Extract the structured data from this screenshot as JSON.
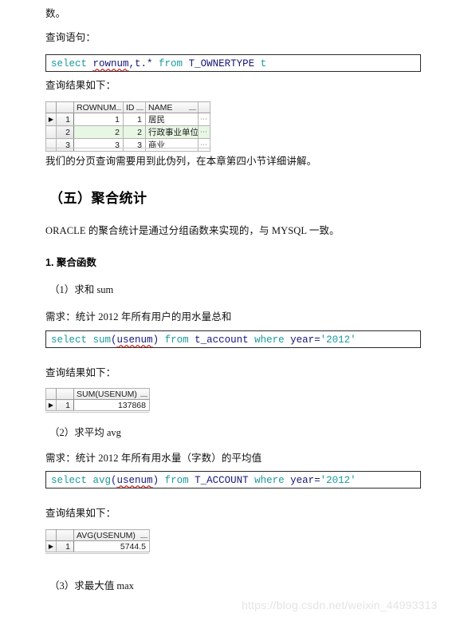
{
  "document": {
    "watermark": "https://blog.csdn.net/weixin_44993313"
  },
  "blocks": {
    "intro_fragment": "数。",
    "label_query_statement": "查询语句：",
    "label_result_1": "查询结果如下：",
    "note_rownum": "我们的分页查询需要用到此伪列，在本章第四小节详细讲解。",
    "section_heading": "（五）聚合统计",
    "section_intro": "ORACLE 的聚合统计是通过分组函数来实现的，与 MYSQL 一致。",
    "subheading_1": "1. 聚合函数",
    "item_1": "（1）求和   sum",
    "requirement_1": "需求：统计 2012 年所有用户的用水量总和",
    "label_result_2": "查询结果如下：",
    "item_2": "（2）求平均 avg",
    "requirement_2": "需求：统计 2012 年所有用水量（字数）的平均值",
    "label_result_3": "查询结果如下：",
    "item_3": "（3）求最大值 max"
  },
  "code": {
    "sql_rownum": {
      "tokens": [
        {
          "t": "select ",
          "c": "kw"
        },
        {
          "t": "rownum",
          "c": "id-squiggle"
        },
        {
          "t": ",t.* ",
          "c": "id"
        },
        {
          "t": "from ",
          "c": "kw"
        },
        {
          "t": "T_OWNERTYPE ",
          "c": "id"
        },
        {
          "t": "t",
          "c": "kw"
        }
      ],
      "plain": "select rownum,t.* from T_OWNERTYPE t"
    },
    "sql_sum": {
      "tokens": [
        {
          "t": "select ",
          "c": "kw"
        },
        {
          "t": "sum",
          "c": "kw"
        },
        {
          "t": "(",
          "c": "pun"
        },
        {
          "t": "usenum",
          "c": "id-squiggle"
        },
        {
          "t": ") ",
          "c": "pun"
        },
        {
          "t": "from ",
          "c": "kw"
        },
        {
          "t": "t_account ",
          "c": "id"
        },
        {
          "t": "where ",
          "c": "kw"
        },
        {
          "t": "year",
          "c": "id"
        },
        {
          "t": "=",
          "c": "pun"
        },
        {
          "t": "'2012'",
          "c": "str"
        }
      ],
      "plain": "select sum(usenum) from t_account where year='2012'"
    },
    "sql_avg": {
      "tokens": [
        {
          "t": "select ",
          "c": "kw"
        },
        {
          "t": "avg",
          "c": "kw"
        },
        {
          "t": "(",
          "c": "pun"
        },
        {
          "t": "usenum",
          "c": "id-squiggle"
        },
        {
          "t": ") ",
          "c": "pun"
        },
        {
          "t": "from ",
          "c": "kw"
        },
        {
          "t": "T_ACCOUNT ",
          "c": "id"
        },
        {
          "t": "where ",
          "c": "kw"
        },
        {
          "t": "year",
          "c": "id"
        },
        {
          "t": "=",
          "c": "pun"
        },
        {
          "t": "'2012'",
          "c": "str"
        }
      ],
      "plain": "select avg(usenum) from T_ACCOUNT where year='2012'"
    }
  },
  "grids": {
    "ownertype": {
      "columns": [
        "ROWNUM",
        "ID",
        "NAME"
      ],
      "rows": [
        {
          "n": "1",
          "selected": true,
          "cells": [
            "1",
            "1",
            "居民"
          ],
          "overflow": "⋯"
        },
        {
          "n": "2",
          "selected": false,
          "cells": [
            "2",
            "2",
            "行政事业单位"
          ],
          "overflow": "⋯"
        },
        {
          "n": "3",
          "selected": false,
          "cells": [
            "3",
            "3",
            "商业"
          ],
          "overflow": "⋯"
        }
      ],
      "marker": "▶"
    },
    "sum_result": {
      "columns": [
        "SUM(USENUM)"
      ],
      "rows": [
        {
          "n": "1",
          "selected": true,
          "cells": [
            "137868"
          ]
        }
      ],
      "marker": "▶"
    },
    "avg_result": {
      "columns": [
        "AVG(USENUM)"
      ],
      "rows": [
        {
          "n": "1",
          "selected": true,
          "cells": [
            "5744.5"
          ]
        }
      ],
      "marker": "▶"
    }
  }
}
